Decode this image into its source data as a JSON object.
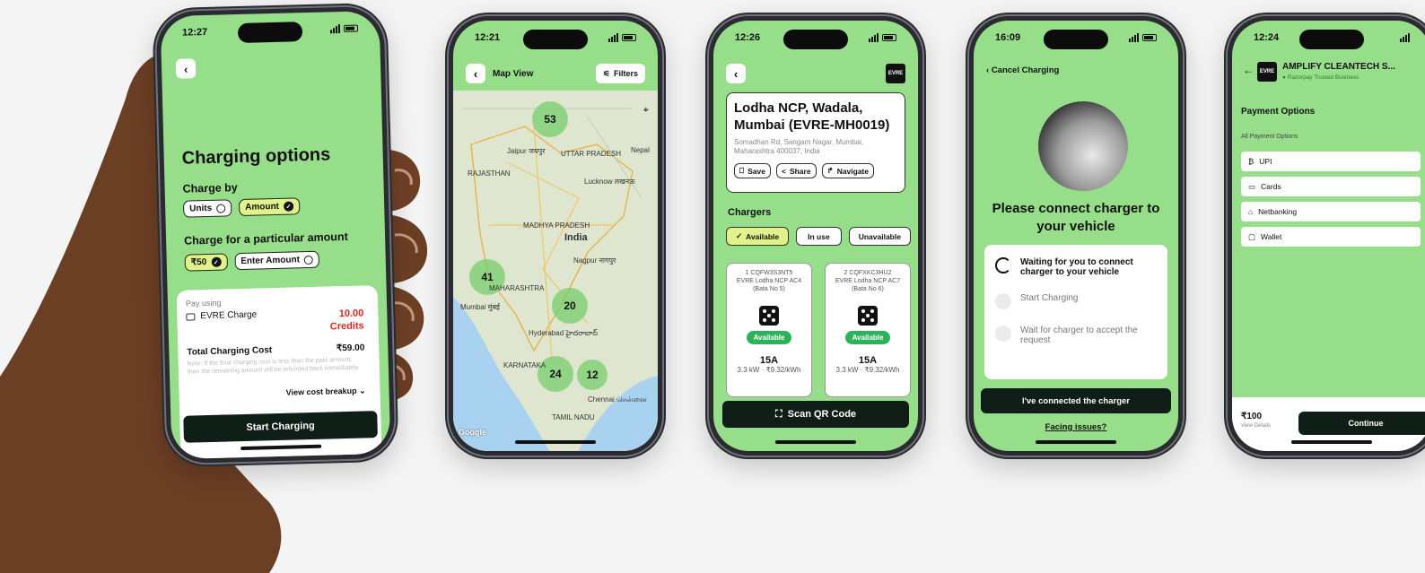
{
  "phone1": {
    "time": "12:27",
    "title": "Charging options",
    "charge_by_label": "Charge by",
    "units_label": "Units",
    "amount_label": "Amount",
    "particular_label": "Charge for a particular amount",
    "amount_chip": "₹50",
    "enter_amount": "Enter Amount",
    "pay_using_label": "Pay using",
    "pay_method": "EVRE Charge",
    "credits_value": "10.00",
    "credits_label": "Credits",
    "total_label": "Total Charging Cost",
    "total_value": "₹59.00",
    "note": "Note: If the final charging cost is less than the paid amount, then the remaining amount will be refunded back immediately.",
    "breakup_label": "View cost breakup",
    "cta": "Start Charging"
  },
  "phone2": {
    "time": "12:21",
    "title": "Map View",
    "filters_label": "Filters",
    "clusters": [
      {
        "count": "53"
      },
      {
        "count": "41"
      },
      {
        "count": "20"
      },
      {
        "count": "24"
      },
      {
        "count": "12"
      }
    ],
    "labels": [
      "Jaipur जयपुर",
      "UTTAR PRADESH",
      "Lucknow लखनऊ",
      "Nepal",
      "RAJASTHAN",
      "India",
      "MADHYA PRADESH",
      "Nagpur नागपुर",
      "MAHARASHTRA",
      "Mumbai मुंबई",
      "Hyderabad హైదరాబాద్",
      "KARNATAKA",
      "Chennai சென்னை",
      "TAMIL NADU"
    ],
    "google": "Google"
  },
  "phone3": {
    "time": "12:26",
    "logo": "EVRE",
    "station_name": "Lodha NCP, Wadala, Mumbai (EVRE-MH0019)",
    "address": "Somadhan Rd, Sangam Nagar, Mumbai, Maharashtra 400037, India",
    "save": "Save",
    "share": "Share",
    "navigate": "Navigate",
    "chargers_label": "Chargers",
    "filter_available": "Available",
    "filter_in_use": "In use",
    "filter_unavailable": "Unavailable",
    "chargers": [
      {
        "index": "1",
        "code": "CQFW3S3NT5",
        "desc": "EVRE Lodha NCP AC4 (Bata No 5)",
        "status": "Available",
        "amps": "15A",
        "rate": "3.3 kW · ₹9.32/kWh"
      },
      {
        "index": "2",
        "code": "CQFXKC3HU2",
        "desc": "EVRE Lodha NCP AC7 (Bata No 6)",
        "status": "Available",
        "amps": "15A",
        "rate": "3.3 kW · ₹9.32/kWh"
      }
    ],
    "scan_label": "Scan QR Code"
  },
  "phone4": {
    "time": "16:09",
    "cancel_label": "Cancel Charging",
    "headline": "Please connect charger to your vehicle",
    "steps": [
      {
        "text": "Waiting for you to connect charger to your vehicle"
      },
      {
        "text": "Start Charging"
      },
      {
        "text": "Wait for charger to accept the request"
      }
    ],
    "cta": "I've connected the charger",
    "issues": "Facing issues?"
  },
  "phone5": {
    "time": "12:24",
    "merchant": "AMPLIFY CLEANTECH S...",
    "merchant_sub": "Razorpay Trusted Business",
    "logo": "EVRE",
    "section_title": "Payment Options",
    "all_options": "All Payment Options",
    "options": [
      {
        "label": "UPI"
      },
      {
        "label": "Cards"
      },
      {
        "label": "Netbanking"
      },
      {
        "label": "Wallet"
      }
    ],
    "amount": "₹100",
    "view_details": "View Details",
    "cta": "Continue"
  },
  "colors": {
    "screen_bg": "#97de8a",
    "dark_button": "#0f1f17",
    "selected_chip": "#e0f28a",
    "available_green": "#2bb35a",
    "credits_red": "#e0251b"
  }
}
